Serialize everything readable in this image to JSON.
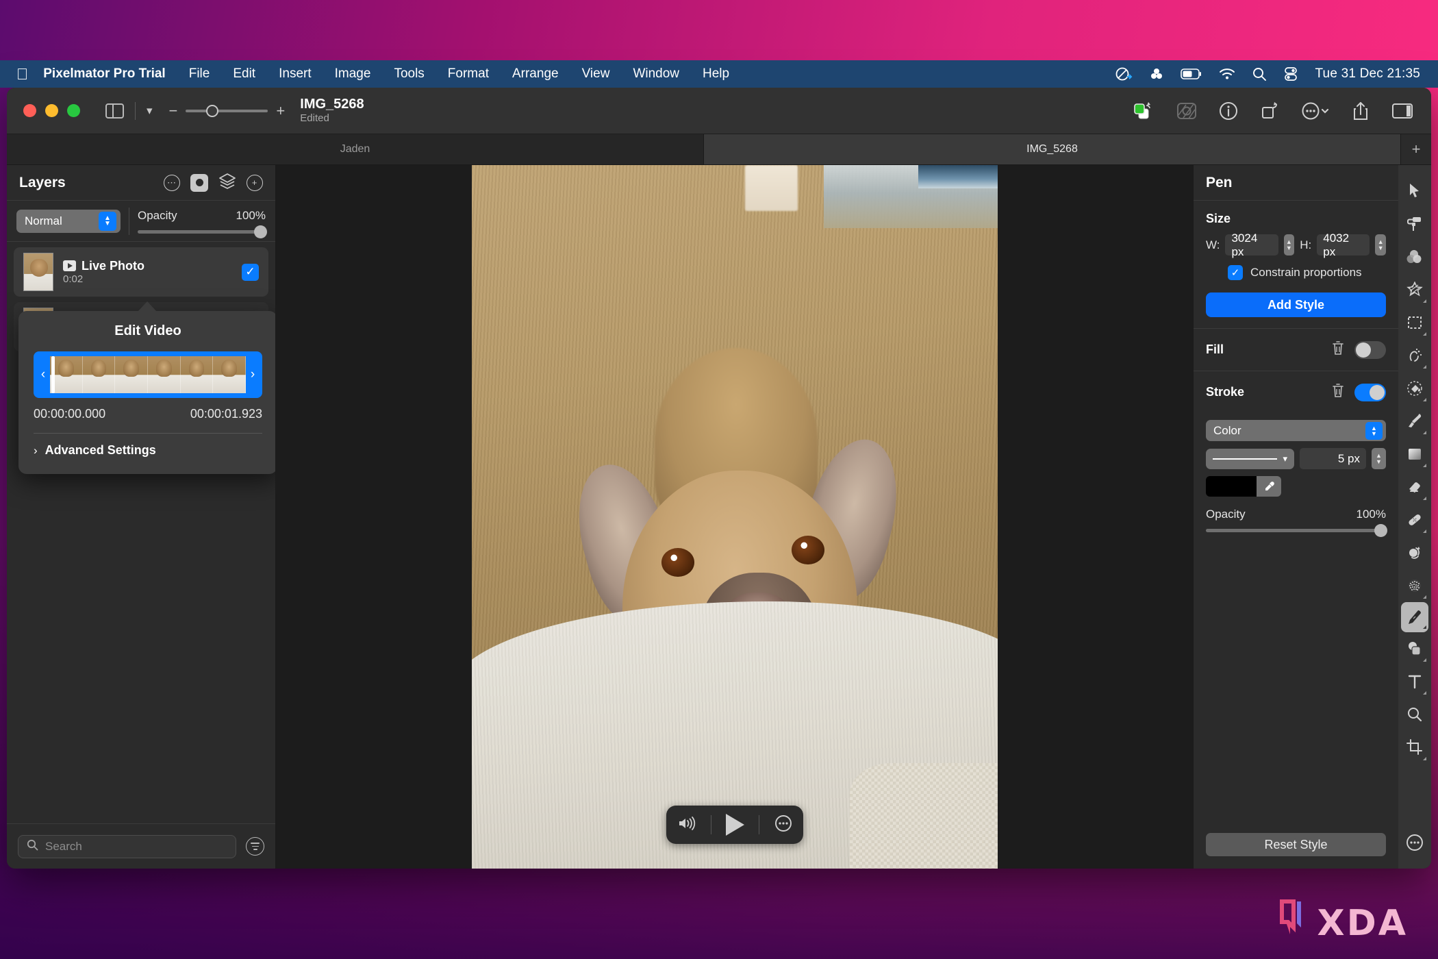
{
  "menubar": {
    "apple_icon": "apple-logo",
    "app_name": "Pixelmator Pro Trial",
    "items": [
      "File",
      "Edit",
      "Insert",
      "Image",
      "Tools",
      "Format",
      "Arrange",
      "View",
      "Window",
      "Help"
    ],
    "status_icons": [
      "cleanshot-icon",
      "dropbox-icon",
      "battery-icon",
      "wifi-icon",
      "spotlight-search-icon",
      "control-center-icon"
    ],
    "clock": "Tue 31 Dec  21:35"
  },
  "toolbar": {
    "traffic_lights": [
      "close",
      "minimize",
      "zoom"
    ],
    "sidebar_toggle_icon": "sidebar-icon",
    "chevron_icon": "chevron-down-icon",
    "zoom_out": "−",
    "zoom_in": "+",
    "document_title": "IMG_5268",
    "document_subtitle": "Edited",
    "right_icons": [
      "color-swatch-icon",
      "effects-icon",
      "info-icon",
      "rotate-icon",
      "more-icon",
      "share-icon",
      "panel-toggle-icon"
    ]
  },
  "tabs": [
    {
      "label": "Jaden",
      "active": false
    },
    {
      "label": "IMG_5268",
      "active": true
    }
  ],
  "tab_add_label": "+",
  "layers_panel": {
    "title": "Layers",
    "head_icons": [
      "more-options-icon",
      "mask-icon",
      "layers-stack-icon",
      "add-layer-icon"
    ],
    "blend_mode": "Normal",
    "opacity_label": "Opacity",
    "opacity_value": "100%",
    "layer": {
      "name": "Live Photo",
      "duration": "0:02",
      "checked": true,
      "badge_icon": "play-badge-icon"
    },
    "search_placeholder": "Search",
    "search_value": "",
    "filter_icon": "filter-icon"
  },
  "popover": {
    "title": "Edit Video",
    "prev_icon": "chevron-left-icon",
    "next_icon": "chevron-right-icon",
    "start_time": "00:00:00.000",
    "end_time": "00:00:01.923",
    "advanced_label": "Advanced Settings",
    "advanced_chevron": "chevron-right-icon"
  },
  "player": {
    "volume_icon": "volume-icon",
    "play_icon": "play-icon",
    "more_icon": "more-icon"
  },
  "inspector": {
    "title": "Pen",
    "size_label": "Size",
    "width_label": "W:",
    "width_value": "3024 px",
    "height_label": "H:",
    "height_value": "4032 px",
    "constrain_label": "Constrain proportions",
    "constrain_checked": true,
    "add_style_label": "Add Style",
    "fill": {
      "label": "Fill",
      "enabled": false,
      "trash_icon": "trash-icon"
    },
    "stroke": {
      "label": "Stroke",
      "enabled": true,
      "trash_icon": "trash-icon",
      "type": "Color",
      "line_style_icon": "solid-line-icon",
      "width_value": "5 px",
      "color_hex": "#000000",
      "eyedropper_icon": "eyedropper-icon",
      "opacity_label": "Opacity",
      "opacity_value": "100%"
    },
    "reset_label": "Reset Style"
  },
  "tools": [
    {
      "name": "arrange-tool",
      "icon": "cursor-arrow-icon",
      "selected": false
    },
    {
      "name": "color-adjustments-tool",
      "icon": "paint-roller-icon",
      "selected": false
    },
    {
      "name": "color-balance-tool",
      "icon": "color-circles-icon",
      "selected": false
    },
    {
      "name": "effects-tool",
      "icon": "magic-wand-icon",
      "selected": false
    },
    {
      "name": "selection-tool",
      "icon": "marquee-icon",
      "selected": false
    },
    {
      "name": "quick-selection-tool",
      "icon": "quick-select-icon",
      "selected": false
    },
    {
      "name": "paint-tool",
      "icon": "paint-bucket-icon",
      "selected": false
    },
    {
      "name": "brush-tool",
      "icon": "paintbrush-icon",
      "selected": false
    },
    {
      "name": "gradient-tool",
      "icon": "gradient-icon",
      "selected": false
    },
    {
      "name": "eraser-tool",
      "icon": "eraser-icon",
      "selected": false
    },
    {
      "name": "repair-tool",
      "icon": "bandage-icon",
      "selected": false
    },
    {
      "name": "clone-tool",
      "icon": "clone-stamp-icon",
      "selected": false
    },
    {
      "name": "retouch-tool",
      "icon": "dither-icon",
      "selected": false
    },
    {
      "name": "pen-tool",
      "icon": "pen-nib-icon",
      "selected": true
    },
    {
      "name": "shape-tool",
      "icon": "shapes-icon",
      "selected": false
    },
    {
      "name": "type-tool",
      "icon": "text-t-icon",
      "selected": false
    },
    {
      "name": "zoom-tool",
      "icon": "magnifier-icon",
      "selected": false
    },
    {
      "name": "crop-tool",
      "icon": "crop-icon",
      "selected": false
    },
    {
      "name": "more-tools",
      "icon": "more-circle-icon",
      "selected": false
    }
  ],
  "watermark": {
    "text": "XDA",
    "badge_icon": "xda-badge-icon"
  },
  "colors": {
    "accent_blue": "#0a7cff",
    "menubar_blue": "#1e4570",
    "panel_gray": "#2b2b2b",
    "canvas_gray": "#1c1c1c",
    "toolbar_gray": "#323232"
  }
}
